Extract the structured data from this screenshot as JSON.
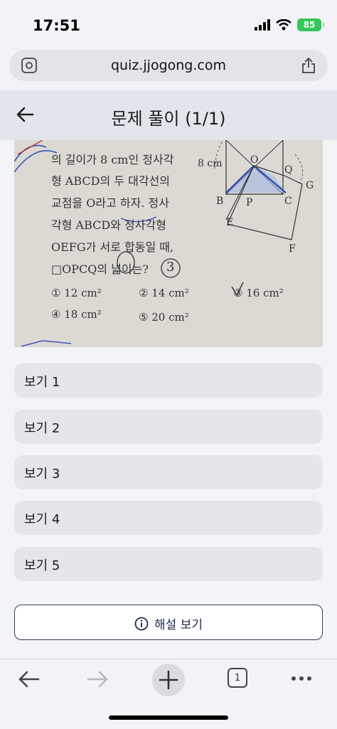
{
  "status": {
    "time": "17:51",
    "battery": "85"
  },
  "browser": {
    "url": "quiz.jjogong.com"
  },
  "header": {
    "title": "문제 풀이 (1/1)"
  },
  "question": {
    "lines": [
      "의 길이가 8 cm인 정사각",
      "형 ABCD의 두 대각선의",
      "교점을 O라고 하자. 정사",
      "각형 ABCD와 정사각형",
      "OEFG가 서로 합동일 때,",
      "□OPCQ의 넓이는?"
    ],
    "choices": [
      "① 12 cm²",
      "② 14 cm²",
      "③ 16 cm²",
      "④ 18 cm²",
      "⑤ 20 cm²"
    ],
    "figure_labels": {
      "side": "8 cm",
      "O": "O",
      "Q": "Q",
      "G": "G",
      "B": "B",
      "P": "P",
      "C": "C",
      "E": "E",
      "F": "F"
    },
    "handwritten": "3"
  },
  "options": [
    "보기 1",
    "보기 2",
    "보기 3",
    "보기 4",
    "보기 5"
  ],
  "explain_label": "해설 보기",
  "tab_count": "1"
}
